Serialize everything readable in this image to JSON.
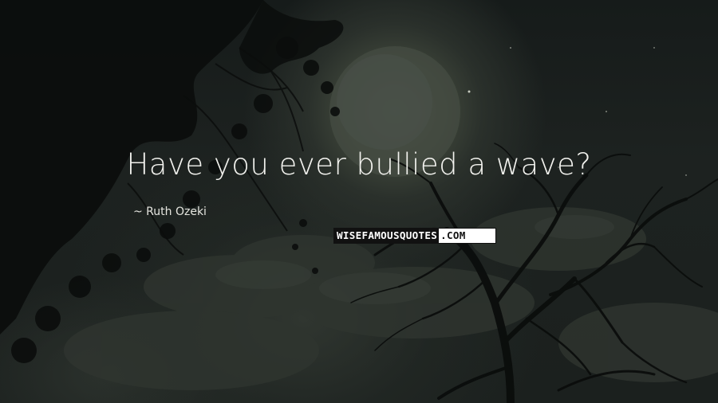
{
  "quote": {
    "text": "Have you ever bullied a wave?",
    "author": "~ Ruth Ozeki"
  },
  "watermark": {
    "part1": "WISEFAMOUSQUOTES",
    "part2": ".COM"
  },
  "colors": {
    "text": "#f2f2ee",
    "background": "#1a1f1d",
    "moon": "#4b5248",
    "tree": "#0b0d0c"
  },
  "scene": {
    "moon_description_name": "full-moon",
    "silhouettes": "tree-silhouette"
  }
}
